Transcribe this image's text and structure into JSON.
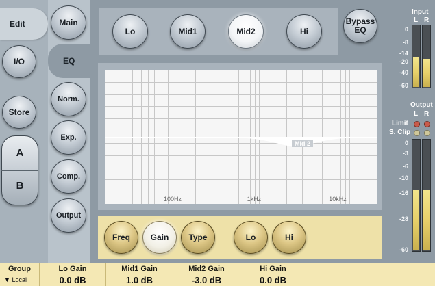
{
  "left_tabs": {
    "edit": "Edit",
    "io": "I/O",
    "store": "Store",
    "a": "A",
    "b": "B"
  },
  "sub_tabs": {
    "main": "Main",
    "eq": "EQ",
    "norm": "Norm.",
    "exp": "Exp.",
    "comp": "Comp.",
    "output": "Output"
  },
  "bands": {
    "lo": "Lo",
    "mid1": "Mid1",
    "mid2": "Mid2",
    "hi": "Hi",
    "active": "mid2"
  },
  "bypass": {
    "line1": "Bypass",
    "line2": "EQ"
  },
  "graph": {
    "band_marker": "Mid 2",
    "freq_labels": [
      "100Hz",
      "1kHz",
      "10kHz"
    ]
  },
  "params": {
    "freq": "Freq",
    "gain": "Gain",
    "type": "Type",
    "lo": "Lo",
    "hi": "Hi",
    "active": "gain"
  },
  "input_meter": {
    "title": "Input",
    "left": "L",
    "right": "R",
    "ticks": [
      "0",
      "-8",
      "-14",
      "-20",
      "-40",
      "-60"
    ],
    "level_left_db": -19,
    "level_right_db": -20
  },
  "output_meter": {
    "title": "Output",
    "left": "L",
    "right": "R",
    "limit_label": "Limit",
    "sclip_label": "S. Clip",
    "ticks": [
      "0",
      "-3",
      "-6",
      "-10",
      "-16",
      "-28",
      "-60"
    ],
    "level_left_db": -16,
    "level_right_db": -16
  },
  "footer": {
    "group_label": "Group",
    "group_value": "Local",
    "lo_gain_label": "Lo Gain",
    "lo_gain_value": "0.0 dB",
    "mid1_gain_label": "Mid1 Gain",
    "mid1_gain_value": "1.0 dB",
    "mid2_gain_label": "Mid2 Gain",
    "mid2_gain_value": "-3.0 dB",
    "hi_gain_label": "Hi Gain",
    "hi_gain_value": "0.0 dB"
  },
  "colors": {
    "panel": "#8e9aa4",
    "graph_bg": "#f5f5f5",
    "footer": "#f4e8b4",
    "meter_fill": "#e7d06a",
    "led_red": "#c85a4a",
    "led_yellow": "#cfc79a"
  }
}
